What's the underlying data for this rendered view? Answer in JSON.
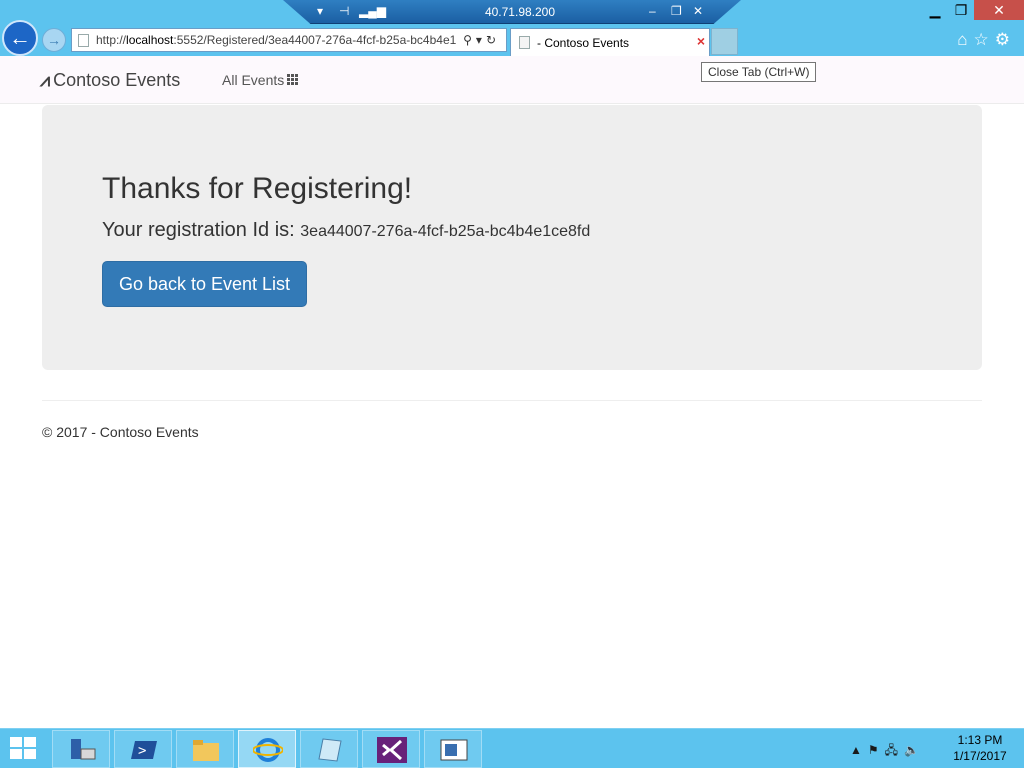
{
  "browser": {
    "rdp_ip": "40.71.98.200",
    "url_prefix": "http://",
    "url_host": "localhost",
    "url_rest": ":5552/Registered/3ea44007-276a-4fcf-b25a-bc4b4e1",
    "tab_title": "- Contoso Events",
    "tab_close_glyph": "×",
    "tooltip": "Close Tab (Ctrl+W)",
    "icons": [
      "back-arrow-icon",
      "forward-arrow-icon",
      "search-icon",
      "refresh-icon",
      "home-icon",
      "favorites-star-icon",
      "settings-gear-icon"
    ]
  },
  "window_controls": {
    "minimize": "▁",
    "restore": "❐",
    "close": "✕"
  },
  "navbar": {
    "brand": "Contoso Events",
    "brand_icon": "road-icon",
    "all_events": "All Events"
  },
  "main": {
    "heading": "Thanks for Registering!",
    "reg_label": "Your registration Id is:",
    "reg_id": "3ea44007-276a-4fcf-b25a-bc4b4e1ce8fd",
    "back_button": "Go back to Event List"
  },
  "footer": {
    "text": "© 2017 - Contoso Events"
  },
  "taskbar": {
    "items": [
      "server-manager-icon",
      "powershell-icon",
      "file-explorer-icon",
      "internet-explorer-icon",
      "notepad-icon",
      "visual-studio-icon",
      "remote-desktop-icon"
    ],
    "clock_time": "1:13 PM",
    "clock_date": "1/17/2017"
  },
  "colors": {
    "primary": "#337ab7",
    "chrome": "#5cc3ee",
    "jumbotron": "#eeeeee"
  }
}
